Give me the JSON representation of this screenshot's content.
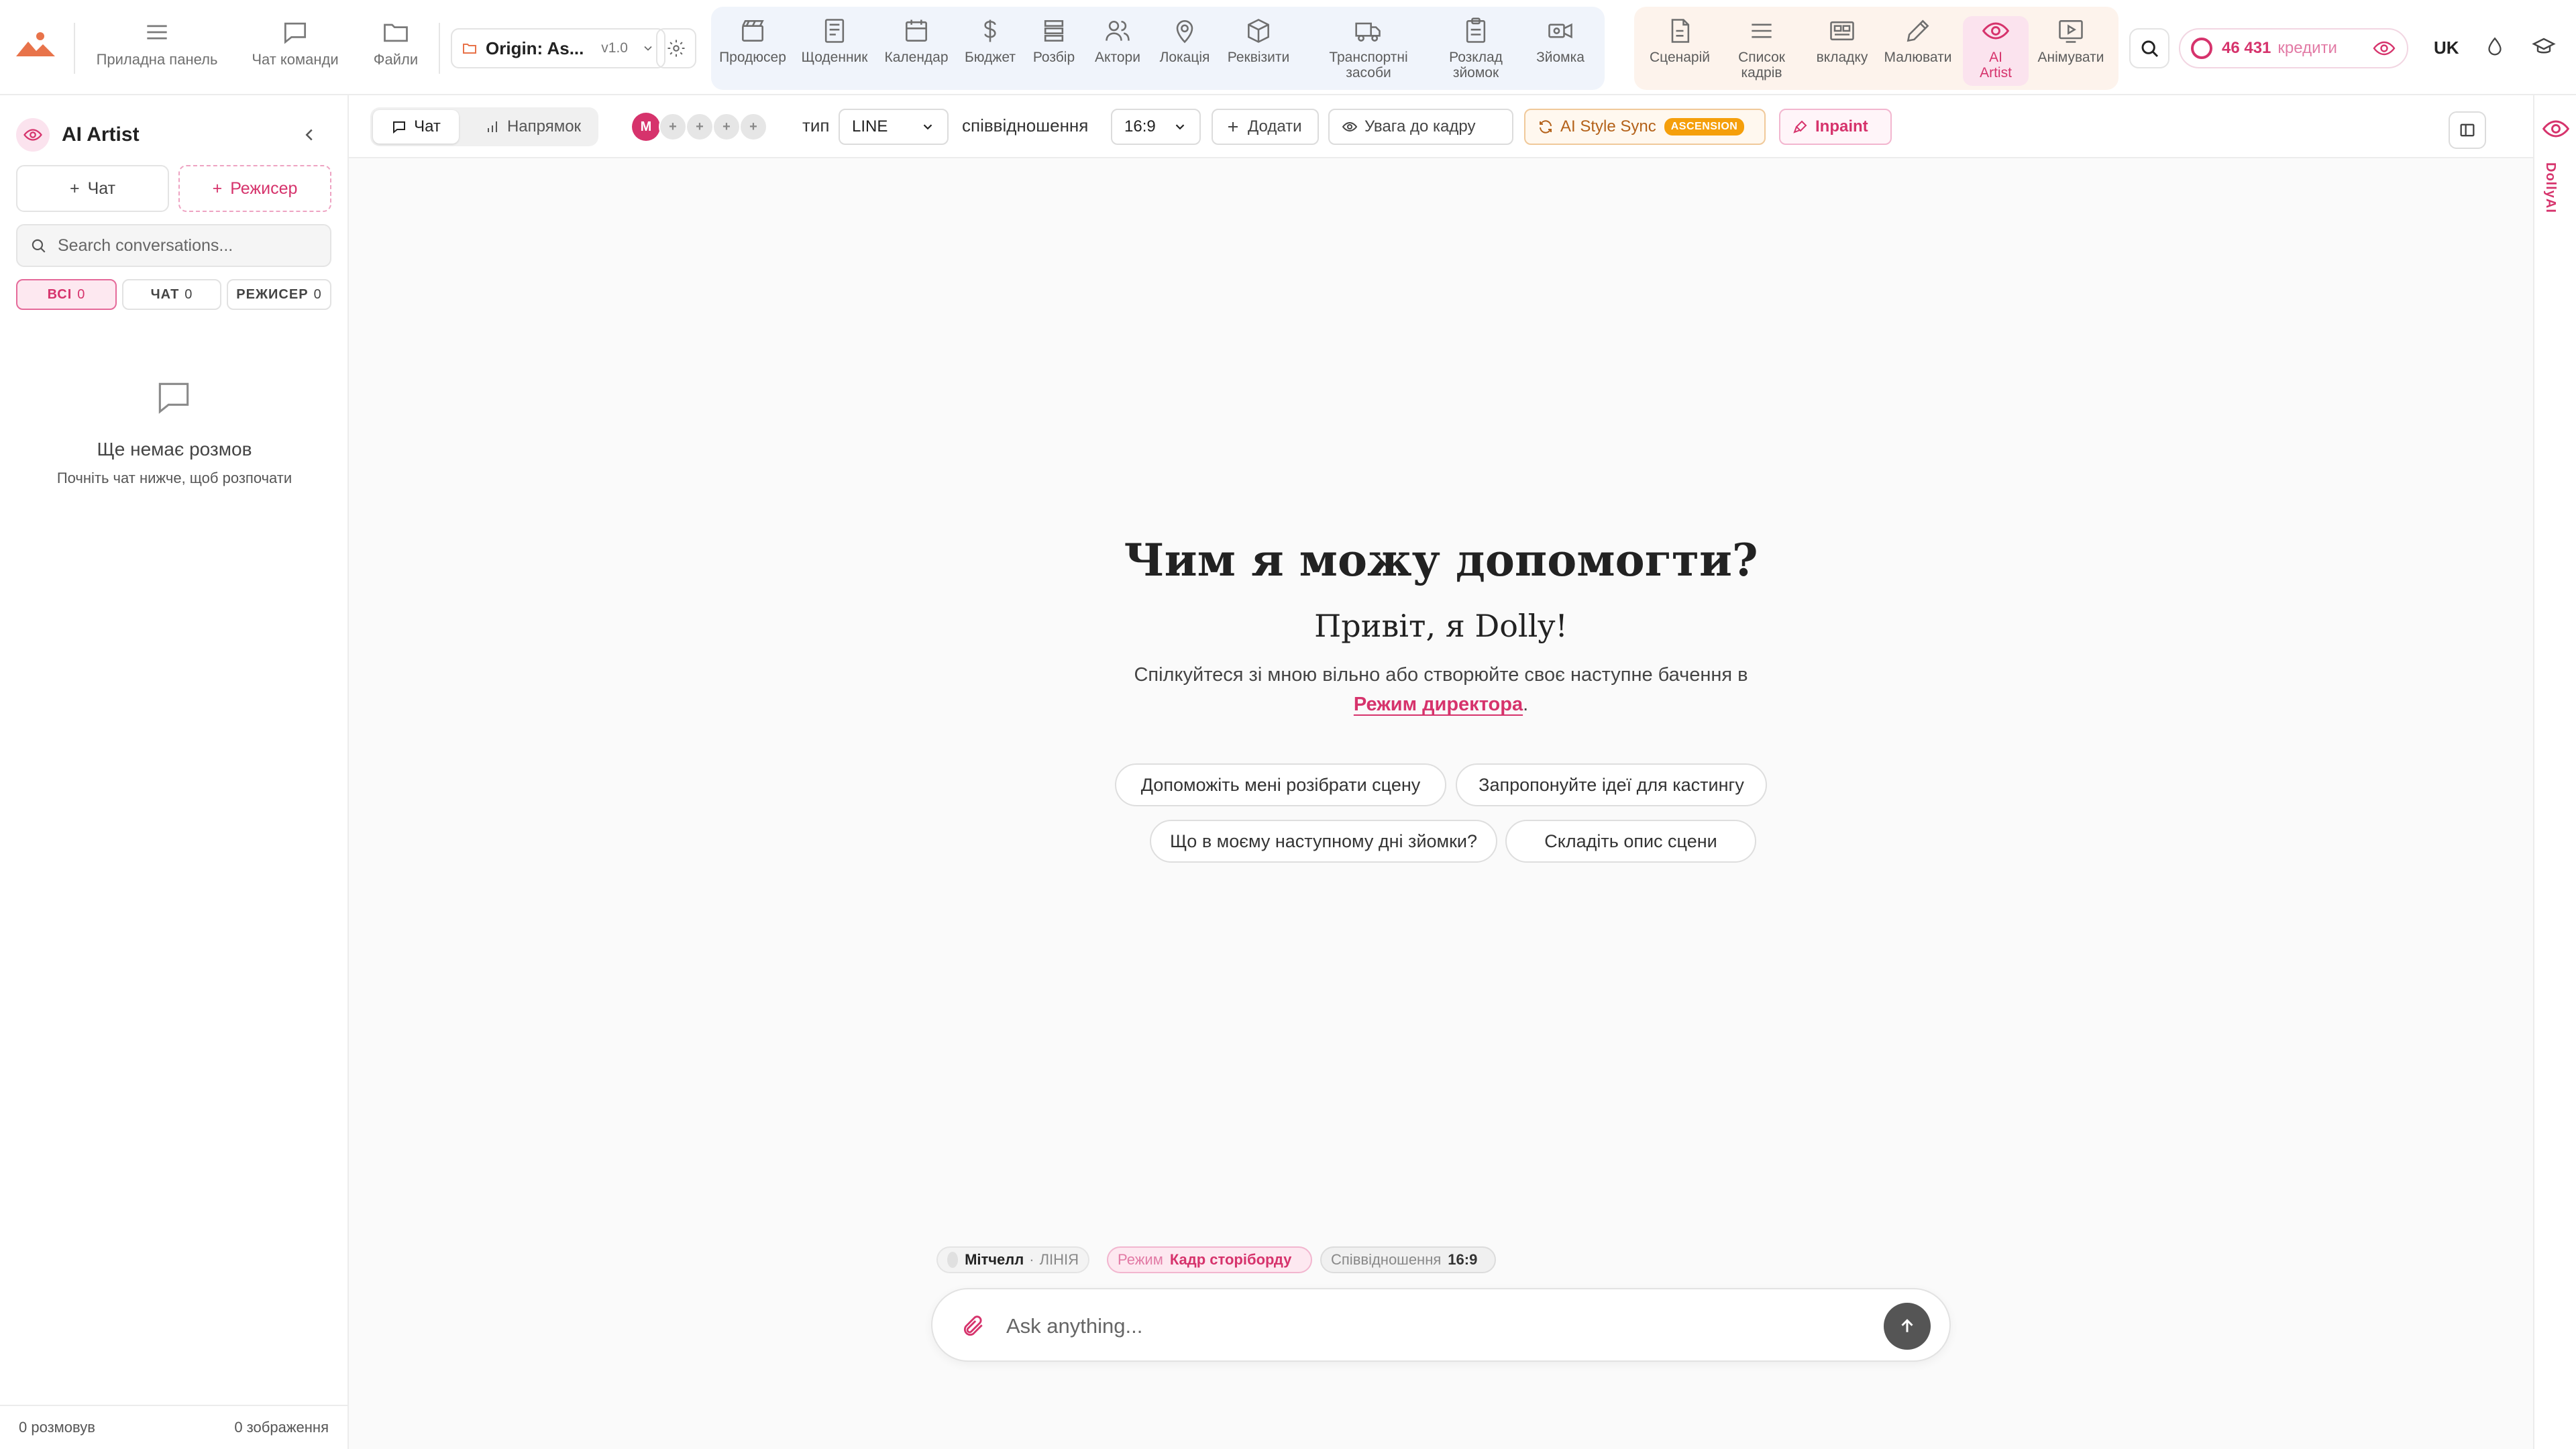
{
  "topnav": {
    "logo": "dolly-logo",
    "items": [
      {
        "label": "Приладна панель",
        "icon": "menu-icon"
      },
      {
        "label": "Чат команди",
        "icon": "chat-bubble-icon"
      },
      {
        "label": "Файли",
        "icon": "folder-icon"
      }
    ],
    "project": {
      "name": "Origin: As...",
      "version": "v1.0"
    },
    "production_tools": [
      {
        "label": "Продюсер",
        "icon": "clapperboard-icon"
      },
      {
        "label": "Щоденник",
        "icon": "journal-icon"
      },
      {
        "label": "Календар",
        "icon": "calendar-icon"
      },
      {
        "label": "Бюджет",
        "icon": "dollar-icon"
      },
      {
        "label": "Розбір",
        "icon": "layers-icon"
      },
      {
        "label": "Актори",
        "icon": "users-icon"
      },
      {
        "label": "Локація",
        "icon": "map-pin-icon"
      },
      {
        "label": "Реквізити",
        "icon": "box-icon"
      },
      {
        "label": "Транспортні засоби",
        "icon": "truck-icon"
      },
      {
        "label": "Розклад зйомок",
        "icon": "clipboard-icon"
      },
      {
        "label": "Зйомка",
        "icon": "video-camera-icon"
      }
    ],
    "creative_tools": [
      {
        "label": "Сценарій",
        "icon": "document-icon"
      },
      {
        "label": "Список кадрів",
        "icon": "list-icon"
      },
      {
        "label": "вкладку",
        "icon": "storyboard-icon"
      },
      {
        "label": "Малювати",
        "icon": "pencil-icon"
      },
      {
        "label": "AI Artist",
        "icon": "eye-icon",
        "active": true
      },
      {
        "label": "Анімувати",
        "icon": "play-screen-icon"
      }
    ],
    "credits": {
      "amount": "46 431",
      "label": "кредити"
    },
    "language": "UK"
  },
  "sidebar": {
    "title": "AI Artist",
    "new_chat": "Чат",
    "new_director": "Режисер",
    "search_placeholder": "Search conversations...",
    "filters": [
      {
        "label": "ВСІ",
        "count": "0"
      },
      {
        "label": "ЧАТ",
        "count": "0"
      },
      {
        "label": "РЕЖИСЕР",
        "count": "0"
      }
    ],
    "empty_title": "Ще немає розмов",
    "empty_subtitle": "Почніть чат нижче, щоб розпочати",
    "footer_conversations": "0 розмовув",
    "footer_images": "0 зображення"
  },
  "toolbar": {
    "tab_chat": "Чат",
    "tab_direction": "Напрямок",
    "avatar_initial": "M",
    "avatar_add": "+",
    "type_label": "тип",
    "type_value": "LINE",
    "ratio_label": "співвідношення",
    "ratio_value": "16:9",
    "add_label": "Додати",
    "attention_label": "Увага до кадру",
    "style_sync_label": "AI Style Sync",
    "style_sync_badge": "ASCENSION",
    "inpaint_label": "Inpaint"
  },
  "rail": {
    "label": "DollyAI"
  },
  "main": {
    "title": "Чим я можу допомогти?",
    "greeting": "Привіт, я Dolly!",
    "description": "Спілкуйтеся зі мною вільно або створюйте своє наступне бачення в",
    "director_link": "Режим директора",
    "period": ".",
    "suggestions": [
      "Допоможіть мені розібрати сцену",
      "Запропонуйте ідеї для кастингу",
      "Що в моєму наступному дні зйомки?",
      "Складіть опис сцени"
    ],
    "context": {
      "person_name": "Мітчелл",
      "person_separator": "·",
      "person_role": "ЛІНІЯ",
      "mode_key": "Режим",
      "mode_value": "Кадр сторіборду",
      "ratio_key": "Співвідношення",
      "ratio_value": "16:9"
    },
    "composer_placeholder": "Ask anything..."
  },
  "colors": {
    "accent": "#d6336c",
    "toolbar_group_blue": "#f0f4fb",
    "toolbar_group_peach": "#fdf3ec"
  }
}
